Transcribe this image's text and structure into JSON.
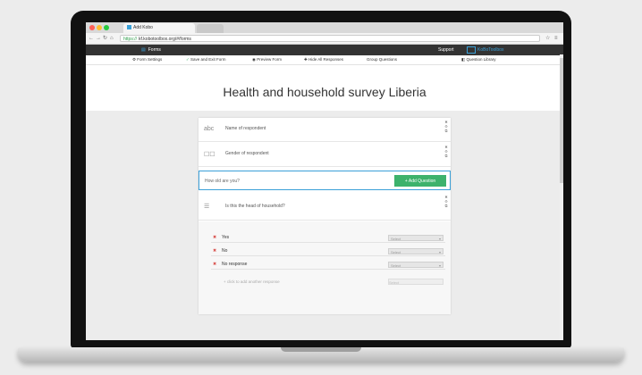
{
  "browser": {
    "tab_title": "Add Kobo",
    "url_prefix": "https://",
    "url": "kf.kobotoolbox.org/#/forms",
    "back_icon": "arrow-left-icon",
    "forward_icon": "arrow-right-icon"
  },
  "header": {
    "forms_label": "Forms",
    "support_label": "Support",
    "brand": "KoBoToolbox"
  },
  "toolbar": {
    "form_settings": "Form Settings",
    "save_and_exit": "Save and Exit Form",
    "preview_form": "Preview Form",
    "hide_all_responses": "Hide All Responses",
    "group_questions": "Group Questions",
    "question_library": "Question Library"
  },
  "survey": {
    "title": "Health and household survey Liberia",
    "questions": [
      {
        "label": "Name of respondent"
      },
      {
        "label": "Gender of respondent"
      }
    ],
    "new_question_value": "How old are you?",
    "add_question_label": "+ Add Question",
    "selected_question": "Is this the head of household?",
    "options": [
      {
        "label": "Yes",
        "type": "Select"
      },
      {
        "label": "No",
        "type": "Select"
      },
      {
        "label": "No response",
        "type": "Select"
      }
    ],
    "add_option_text": "+ click to add another response",
    "add_option_type": "Select"
  },
  "colors": {
    "accent": "#3aa0d8",
    "add_button": "#3db26c",
    "header_bg": "#333333"
  }
}
